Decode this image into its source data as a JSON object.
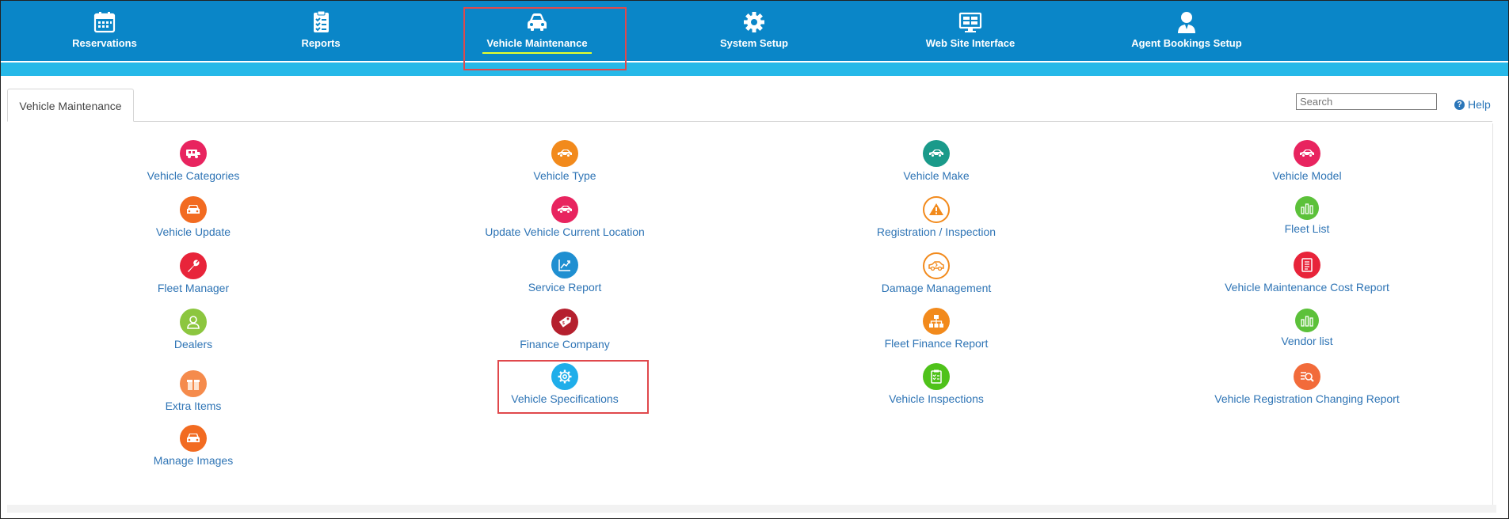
{
  "topnav": {
    "items": [
      {
        "label": "Reservations",
        "icon": "calendar-icon"
      },
      {
        "label": "Reports",
        "icon": "checklist-icon"
      },
      {
        "label": "Vehicle Maintenance",
        "icon": "car-icon",
        "active": true
      },
      {
        "label": "System Setup",
        "icon": "gear-icon"
      },
      {
        "label": "Web Site Interface",
        "icon": "monitor-icon"
      },
      {
        "label": "Agent Bookings Setup",
        "icon": "agent-icon"
      }
    ]
  },
  "tab": {
    "label": "Vehicle Maintenance"
  },
  "search": {
    "placeholder": "Search"
  },
  "help": {
    "label": "Help"
  },
  "colors": {
    "nav_bg": "#0a86c8",
    "stripe": "#26b8e8",
    "link": "#2e74b5",
    "highlight": "#e0484c"
  },
  "menu": {
    "col1": [
      {
        "label": "Vehicle Categories",
        "icon": "camper-icon",
        "color": "#e8245f"
      },
      {
        "label": "Vehicle Update",
        "icon": "car-front-icon",
        "color": "#f26b21"
      },
      {
        "label": "Fleet Manager",
        "icon": "wrench-icon",
        "color": "#e8243a"
      },
      {
        "label": "Dealers",
        "icon": "user-icon",
        "color": "#8cc63f"
      },
      {
        "label": "Extra Items",
        "icon": "box-icon",
        "color": "#f58b4c"
      },
      {
        "label": "Manage Images",
        "icon": "car-front-icon",
        "color": "#f26b21"
      }
    ],
    "col2": [
      {
        "label": "Vehicle Type",
        "icon": "car-side-icon",
        "color": "#f28a1c"
      },
      {
        "label": "Update Vehicle Current Location",
        "icon": "car-side-icon",
        "color": "#e8245f"
      },
      {
        "label": "Service Report",
        "icon": "chart-line-icon",
        "color": "#1f8fd1"
      },
      {
        "label": "Finance Company",
        "icon": "tag-icon",
        "color": "#b5202e"
      },
      {
        "label": "Vehicle Specifications",
        "icon": "gear-icon",
        "color": "#1faeea"
      }
    ],
    "col3": [
      {
        "label": "Vehicle Make",
        "icon": "car-side-icon",
        "color": "#1a9a8a"
      },
      {
        "label": "Registration / Inspection",
        "icon": "warning-icon",
        "color": "#f28a1c"
      },
      {
        "label": "Damage Management",
        "icon": "damaged-car-icon",
        "color": "#f28a1c"
      },
      {
        "label": "Fleet Finance Report",
        "icon": "org-chart-icon",
        "color": "#f28a1c"
      },
      {
        "label": "Vehicle Inspections",
        "icon": "clipboard-icon",
        "color": "#4fc21a"
      }
    ],
    "col4": [
      {
        "label": "Vehicle Model",
        "icon": "car-side-icon",
        "color": "#e8245f"
      },
      {
        "label": "Fleet List",
        "icon": "bar-chart-icon",
        "color": "#5cc13a"
      },
      {
        "label": "Vehicle Maintenance Cost Report",
        "icon": "document-icon",
        "color": "#e8243a"
      },
      {
        "label": "Vendor list",
        "icon": "bar-chart-icon",
        "color": "#5cc13a"
      },
      {
        "label": "Vehicle Registration Changing Report",
        "icon": "search-list-icon",
        "color": "#f26b3a"
      }
    ]
  }
}
